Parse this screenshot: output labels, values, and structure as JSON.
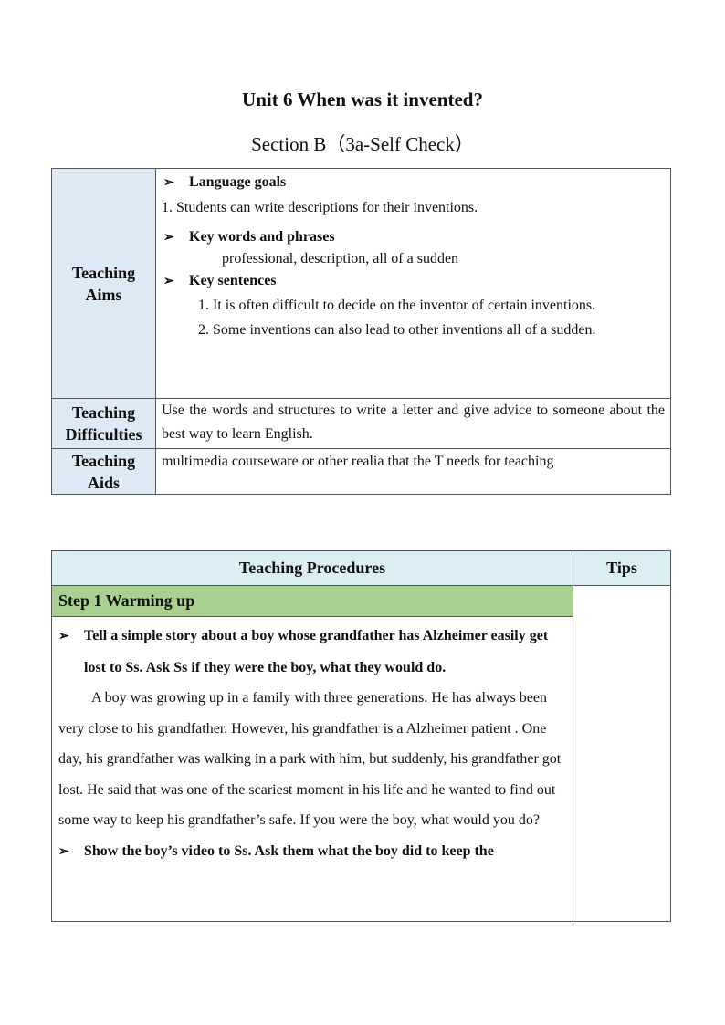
{
  "header": {
    "title": "Unit 6 When was it invented?",
    "subtitle": "Section B（3a-Self Check）"
  },
  "icons": {
    "bullet": "arrow-bullet-icon",
    "bullet_glyph": "➢"
  },
  "aims_table": {
    "teaching_aims": {
      "label_line1": "Teaching",
      "label_line2": "Aims",
      "language_goals_heading": "Language goals",
      "language_goals": "1. Students can write descriptions for their inventions.",
      "key_words_heading": "Key words and phrases",
      "key_words": "professional, description, all  of a sudden",
      "key_sentences_heading": "Key sentences",
      "key_sentences": [
        "1. It is often difficult to decide on the inventor of certain inventions.",
        "2. Some inventions can also lead to other inventions all of a sudden."
      ]
    },
    "teaching_difficulties": {
      "label_line1": "Teaching",
      "label_line2": "Difficulties",
      "text": "Use the words and structures to write a letter and give advice to someone about the best way to learn English."
    },
    "teaching_aids": {
      "label_line1": "Teaching",
      "label_line2": "Aids",
      "text": "multimedia  courseware or other realia that the T needs for teaching"
    }
  },
  "procedures_table": {
    "header_procedures": "Teaching Procedures",
    "header_tips": "Tips",
    "step1": {
      "title": "Step 1 Warming  up",
      "instruction1": "Tell a simple story about a boy whose grandfather has Alzheimer easily get lost to Ss. Ask Ss if they were the boy, what they would do.",
      "story": "A boy was growing up in a family with three generations. He has always been very close to his grandfather. However, his grandfather is a Alzheimer  patient . One day, his grandfather was walking in a park with him, but suddenly, his grandfather got lost. He said that was one of the scariest moment in his life and he wanted to find out some way to keep his grandfather’s safe. If you were the boy, what would you do?",
      "instruction2": "Show the boy’s video to Ss. Ask them what the boy did to keep the"
    }
  },
  "colors": {
    "label_bg": "#dde9f5",
    "proc_header_bg": "#dbeef4",
    "step_bg": "#a9d08e",
    "border": "#555555"
  }
}
